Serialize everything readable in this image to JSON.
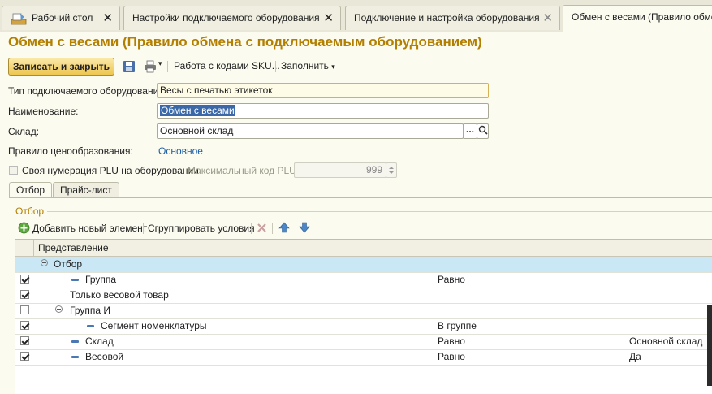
{
  "tabs": [
    {
      "label": "Рабочий стол"
    },
    {
      "label": "Настройки подключаемого оборудования"
    },
    {
      "label": "Подключение и настройка оборудования"
    },
    {
      "label": "Обмен с весами (Правило обмена"
    }
  ],
  "page_title": "Обмен с весами (Правило обмена с подключаемым оборудованием)",
  "toolbar": {
    "save_close": "Записать и закрыть",
    "sku": "Работа с кодами SKU...",
    "fill": "Заполнить"
  },
  "form": {
    "equipment_type_label": "Тип подключаемого оборудования:",
    "equipment_type_value": "Весы с печатью этикеток",
    "name_label": "Наименование:",
    "name_value": "Обмен с весами",
    "warehouse_label": "Склад:",
    "warehouse_value": "Основной склад",
    "pricing_label": "Правило ценообразования:",
    "pricing_value": "Основное",
    "plu_check_label": "Своя нумерация PLU на оборудовании",
    "plu_check_checked": false,
    "max_plu_label": "Максимальный код PLU:",
    "max_plu_value": "999"
  },
  "subtabs": [
    {
      "label": "Отбор"
    },
    {
      "label": "Прайс-лист"
    }
  ],
  "filter": {
    "section_label": "Отбор",
    "add_label": "Добавить новый элемент",
    "group_label": "Сгруппировать условия",
    "column_header": "Представление",
    "rows": [
      {
        "name": "Отбор",
        "op": "",
        "value": "",
        "checked": null
      },
      {
        "name": "Группа",
        "op": "Равно",
        "value": "",
        "checked": true
      },
      {
        "name": "Только весовой товар",
        "op": "",
        "value": "",
        "checked": true
      },
      {
        "name": "Группа И",
        "op": "",
        "value": "",
        "checked": false
      },
      {
        "name": "Сегмент номенклатуры",
        "op": "В группе",
        "value": "",
        "checked": true
      },
      {
        "name": "Склад",
        "op": "Равно",
        "value": "Основной склад",
        "checked": true
      },
      {
        "name": "Весовой",
        "op": "Равно",
        "value": "Да",
        "checked": true
      }
    ]
  },
  "colors": {
    "accent": "#b37f00",
    "link": "#1d5ea8",
    "highlight": "#c9e7f5"
  }
}
